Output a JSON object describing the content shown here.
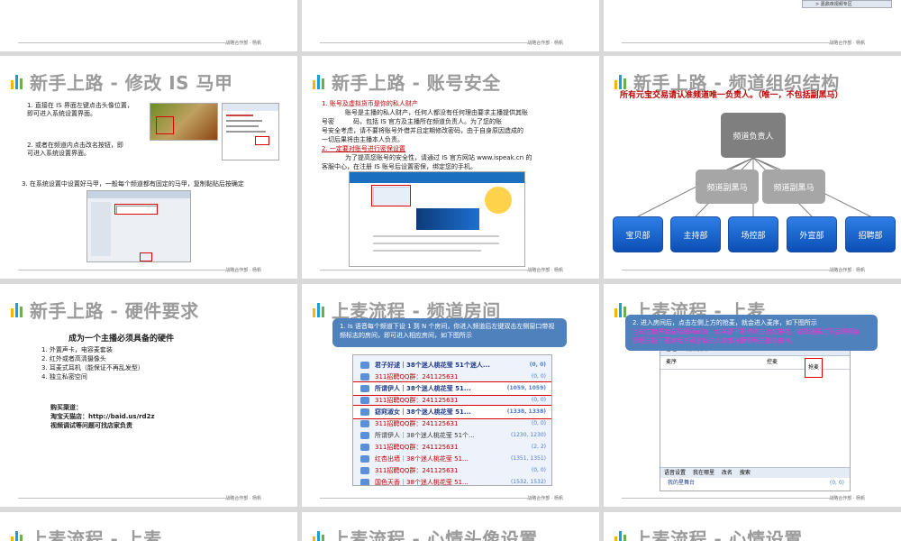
{
  "footer_text": "战略合作部 · 杨帆",
  "top_row": {
    "right_snippet": "> 嘉鼎夜视频专区"
  },
  "slides": {
    "s1": {
      "title": "新手上路 - 修改 IS 马甲",
      "step1": "1. 直接在 IS 界面左键点击头像位置，",
      "step1b": "即可进入系统设置界面。",
      "step2": "2. 或者在频道内点击改名按钮，即",
      "step2b": "可进入系统设置界面。",
      "step3": "3. 在系统设置中设置好马甲，一般每个频道都有固定的马甲，复制黏贴后按确定"
    },
    "s2": {
      "title": "新手上路 - 账号安全",
      "h1": "1. 账号及虚拟货币是你的私人财产",
      "p1a": "账号是主播的私人财产，任何人都没有任何理由要求主播提供其账",
      "p1b": "号密　　　码，包括 IS 官方及主播所在频道负责人。为了您的账",
      "p1c": "号安全考虑，请不要将账号外借并且定期修改密码，由于自身原因造成的",
      "p1d": "一切后果将由主播本人负责。",
      "h2": "2. 一定要对账号进行密保设置",
      "p2a": "为了提高您账号的安全性，请通过 IS 官方网站 www.ispeak.cn 的",
      "p2b": "客服中心，在注册 IS 账号后设置密保，绑定您的手机。"
    },
    "s3": {
      "title": "新手上路 - 频道组织结构",
      "note": "所有元宝交易请认准频道唯一负责人。（唯一，不包括副黑马）",
      "top_node": "频道负责人",
      "mid_nodes": [
        "频道副黑马",
        "频道副黑马"
      ],
      "bottom_nodes": [
        "宝贝部",
        "主持部",
        "场控部",
        "外宣部",
        "招聘部"
      ]
    },
    "s4": {
      "title": "新手上路 - 硬件要求",
      "heading": "成为一个主播必须具备的硬件",
      "items": [
        "1. 外置声卡，电容麦套装",
        "2. 红外或者高清摄像头",
        "3. 耳麦式耳机（能保证不再乱发型）",
        "4. 独立私密空间"
      ],
      "buy_label": "购买渠道：",
      "buy_link": "淘宝天猫店：http://baid.us/rd2z",
      "buy_note": "视频调试等问题可找店家负责"
    },
    "s5": {
      "title": "上麦流程 - 频道房间",
      "desc": "1. Is 语音每个频道下设 1 到 N 个房间，你进入频道后左键双击左侧窗口带视频标志的房间，即可进入相应房间，如下图所示",
      "rooms": [
        {
          "name": "君子好逑｜38个迷人桃花莹 51个迷人...",
          "count": "(0, 0)",
          "style": "blue"
        },
        {
          "name": "311招聘QQ群：241125631",
          "count": "(0, 0)",
          "style": "red"
        },
        {
          "name": "所谓伊人｜38个迷人桃花莹 51...",
          "count": "(1059, 1059)",
          "style": "blue"
        },
        {
          "name": "311招聘QQ群：241125631",
          "count": "(0, 0)",
          "style": "red"
        },
        {
          "name": "窈窕淑女｜38个迷人桃花莹 51...",
          "count": "(1338, 1338)",
          "style": "blue"
        },
        {
          "name": "311招聘QQ群：241125631",
          "count": "(0, 0)",
          "style": "red"
        },
        {
          "name": "所谓伊人｜38个迷人桃花莹 51个...",
          "count": "(1230, 1230)",
          "style": "plain"
        },
        {
          "name": "311招聘QQ群：241125631",
          "count": "(2, 2)",
          "style": "red"
        },
        {
          "name": "红杏出墙｜38个迷人桃花莹 51...",
          "count": "(1351, 1351)",
          "style": "red"
        },
        {
          "name": "311招聘QQ群：241125631",
          "count": "(0, 0)",
          "style": "red"
        },
        {
          "name": "国色天香｜38个迷人桃花莹 51...",
          "count": "(1532, 1532)",
          "style": "red"
        }
      ]
    },
    "s6": {
      "title": "上麦流程 - 上麦",
      "desc1": "2. 进入房间后，点击左侧上方的抢麦，就会进入麦序，如下图所示",
      "desc2": "当前主播开始麦后即可表演，如果要下麦请点击对应按钮，被管理员拉下后需等待",
      "desc3": "管理员拉下麦序后方可重新进入或者根据管理员指令操作。",
      "manage": "管理",
      "mode": "视频模式 ▾",
      "queue": "麦序",
      "control": "控麦",
      "grab": "抢麦",
      "tabs": [
        "语音设置",
        "我在哪里",
        "改名",
        "搜索"
      ],
      "stage": "我的星舞台",
      "stage_count": "(0, 0)"
    },
    "bottom_row": {
      "t1": "上麦流程 - 上麦",
      "t2": "上麦流程 - 心情头像设置",
      "t3": "上麦流程 - 心情设置"
    }
  }
}
